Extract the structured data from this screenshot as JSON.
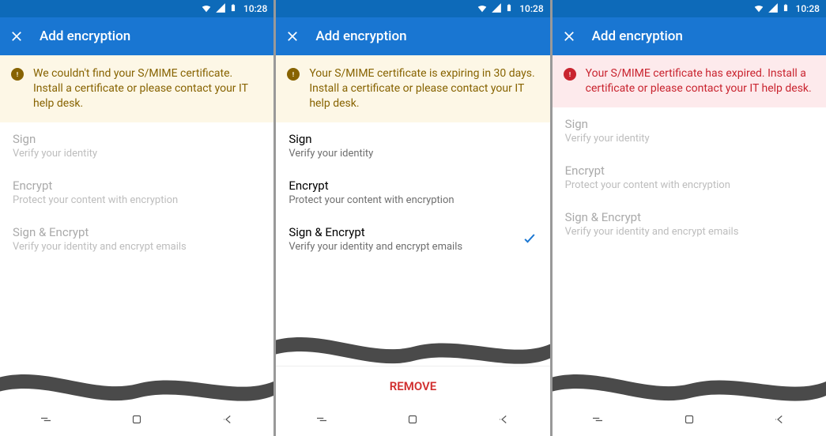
{
  "statusbar": {
    "time": "10:28"
  },
  "appbar": {
    "title": "Add encryption"
  },
  "banners": {
    "not_found": "We couldn't find your S/MIME certificate. Install a certificate or please contact your IT help desk.",
    "expiring": "Your S/MIME certificate is expiring in 30 days. Install a certificate or please contact your IT help desk.",
    "expired": "Your S/MIME certificate has expired. Install a certificate or please contact your IT help desk."
  },
  "options": {
    "sign": {
      "title": "Sign",
      "sub": "Verify your identity"
    },
    "encrypt": {
      "title": "Encrypt",
      "sub": "Protect your content with encryption"
    },
    "sign_encrypt": {
      "title": "Sign & Encrypt",
      "sub": "Verify your identity and encrypt emails"
    }
  },
  "remove_label": "REMOVE"
}
